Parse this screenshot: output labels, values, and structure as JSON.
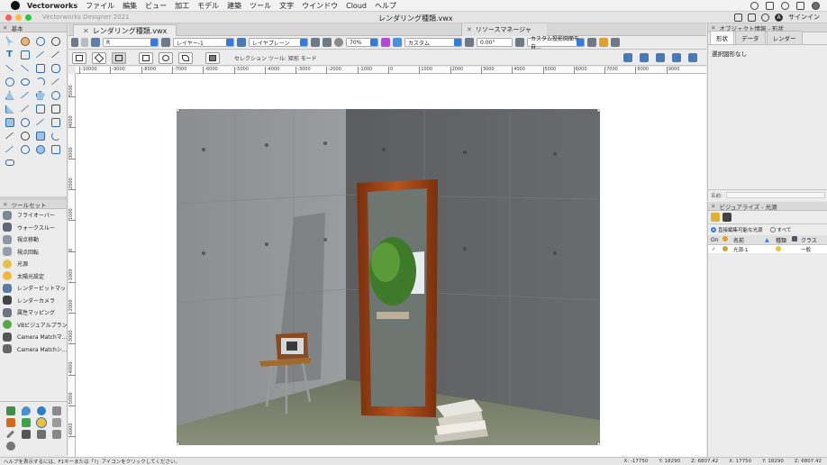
{
  "menubar": {
    "app": "Vectorworks",
    "items": [
      "ファイル",
      "編集",
      "ビュー",
      "加工",
      "モデル",
      "建築",
      "ツール",
      "文字",
      "ウインドウ",
      "Cloud",
      "ヘルプ"
    ],
    "signin": "サインイン",
    "avatar": "A"
  },
  "titlebar": {
    "app_title": "Vectorworks Designer 2021",
    "doc_title": "レンダリング種類.vwx"
  },
  "left_top": {
    "title": "基本"
  },
  "toolset": {
    "title": "ツールセット",
    "items": [
      "フライオーバー",
      "ウォークスルー",
      "視点移動",
      "視点回転",
      "光源",
      "太陽光設定",
      "レンダービットマップ",
      "レンダーカメラ",
      "属性マッピング",
      "VBビジュアルプラント",
      "Camera Matchマ…",
      "Camera Matchシ…"
    ]
  },
  "doc_tab": {
    "label": "レンダリング種類.vwx"
  },
  "resource_manager": {
    "label": "リソースマネージャ"
  },
  "toolbar": {
    "class_value": "R",
    "layer_value": "レイヤー-1",
    "view_value": "レイヤプレーン",
    "zoom_value": "70%",
    "render_value": "カスタム",
    "angle_value": "0.00°",
    "projection_value": "カスタム投影図面を自…"
  },
  "mode_bar": {
    "hint": "セレクション ツール: 矩形 モード"
  },
  "ruler": {
    "h_labels": [
      "-10000",
      "-9000",
      "-8000",
      "-7000",
      "-6000",
      "-5000",
      "-4000",
      "-3000",
      "-2000",
      "-1000",
      "0",
      "1000",
      "2000",
      "3000",
      "4000",
      "5000",
      "6000",
      "7000",
      "8000",
      "9000"
    ],
    "v_labels": [
      "5000",
      "4000",
      "3000",
      "2000",
      "1000",
      "0",
      "-1000",
      "-2000",
      "-3000",
      "-4000",
      "-5000",
      "-6000"
    ]
  },
  "object_info": {
    "title": "オブジェクト情報 - 形状",
    "tabs": [
      "形状",
      "データ",
      "レンダー"
    ],
    "no_selection": "選択図形なし",
    "name_label": "名前:"
  },
  "visualize": {
    "title": "ビジュアライズ - 光源",
    "radio_editable": "直接編集可能な光源",
    "radio_all": "すべて",
    "columns": [
      "On",
      "名前",
      "種類",
      "クラス"
    ],
    "rows": [
      {
        "name": "光源-1",
        "class": "一般"
      }
    ]
  },
  "status": {
    "help": "ヘルプを表示するには、F1キーまたは「?」アイコンをクリックしてください。",
    "x_label": "X:",
    "x_value": "-17750",
    "y_label": "Y:",
    "y_value": "18290",
    "z_label": "Z:",
    "z_value": "6807.42",
    "x2_value": "17750",
    "y2_value": "18290",
    "z2_value": "6807.42"
  }
}
